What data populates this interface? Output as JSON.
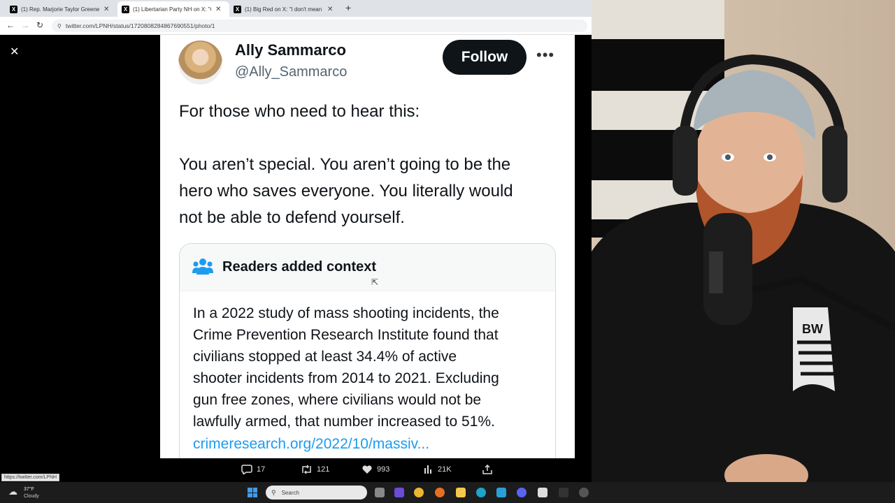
{
  "browser": {
    "tabs": [
      {
        "title": "(1) Rep. Marjorie Taylor Greene"
      },
      {
        "title": "(1) Libertarian Party NH on X: \"C"
      },
      {
        "title": "(1) Big Red on X: \"I don't mean t"
      }
    ],
    "new_tab": "+",
    "url": "twitter.com/LPNH/status/1720808284867690551/photo/1"
  },
  "tweet": {
    "author_name": "Ally Sammarco",
    "author_handle": "@Ally_Sammarco",
    "follow_label": "Follow",
    "more_label": "•••",
    "lines": [
      "For those who need to hear this:",
      "You aren’t special. You aren’t going to be the",
      "hero who saves everyone. You literally would",
      "not be able to defend yourself."
    ],
    "context": {
      "title": "Readers added context",
      "lines": [
        "In a 2022 study of mass shooting incidents, the",
        "Crime Prevention Research Institute found that",
        "civilians stopped at least 34.4% of active",
        "shooter incidents from 2014 to 2021. Excluding",
        "gun free zones, where civilians would not be",
        "lawfully armed, that number increased to 51%."
      ],
      "link": "crimeresearch.org/2022/10/massiv..."
    }
  },
  "actions": {
    "replies": "17",
    "reposts": "121",
    "likes": "993",
    "views": "21K"
  },
  "status_url": "https://twitter.com/LPNH",
  "taskbar": {
    "temperature": "37°F",
    "condition": "Cloudy",
    "search_placeholder": "Search"
  },
  "webcam": {
    "shirt_logo": "BW"
  },
  "colors": {
    "link": "#1d9bf0",
    "follow_bg": "#0f1419",
    "taskbar": "#1c1c1c"
  }
}
